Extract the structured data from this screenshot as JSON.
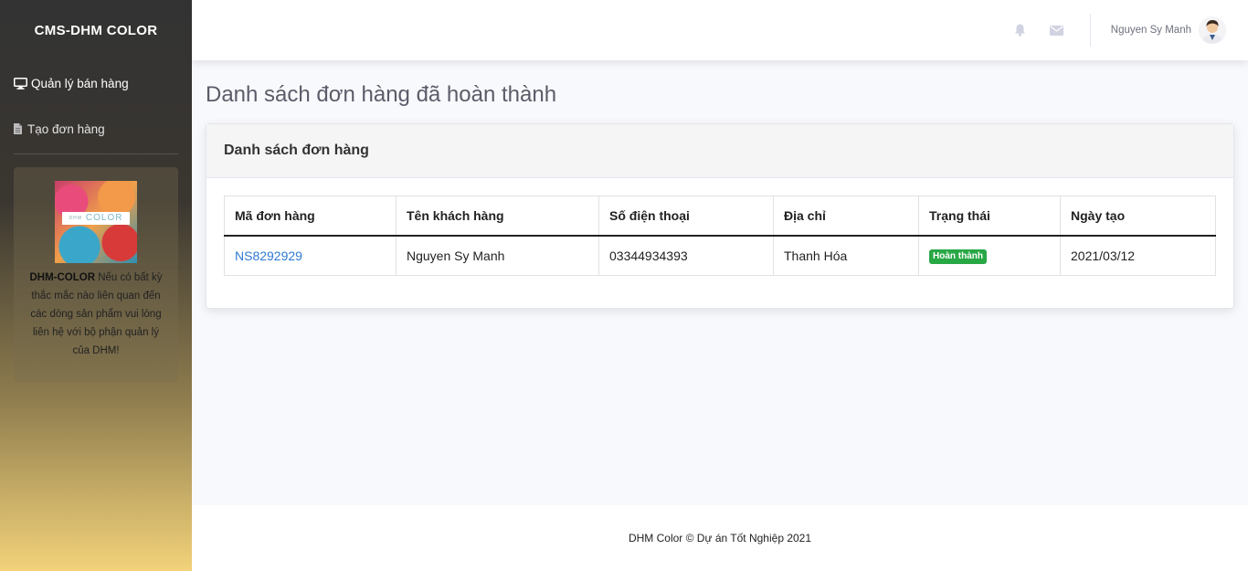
{
  "sidebar": {
    "brand": "CMS-DHM COLOR",
    "items": [
      {
        "label": "Quản lý bán hàng",
        "icon": "monitor-icon"
      },
      {
        "label": "Tạo đơn hàng",
        "icon": "file-icon"
      }
    ],
    "promo": {
      "logo_small": "DHM",
      "logo_text": "COLOR",
      "brand": "DHM-COLOR",
      "text": " Nếu có bất kỳ thắc mắc nào liên quan đến các dòng sản phẩm vui lòng liên hệ với bộ phận quản lý của DHM!"
    }
  },
  "topbar": {
    "user_name": "Nguyen Sy Manh",
    "icons": [
      "bell-icon",
      "envelope-icon"
    ]
  },
  "page": {
    "title": "Danh sách đơn hàng đã hoàn thành"
  },
  "card": {
    "header": "Danh sách đơn hàng"
  },
  "table": {
    "columns": [
      "Mã đơn hàng",
      "Tên khách hàng",
      "Số điện thoại",
      "Địa chỉ",
      "Trạng thái",
      "Ngày tạo"
    ],
    "rows": [
      {
        "order_id": "NS8292929",
        "customer": "Nguyen Sy Manh",
        "phone": "03344934393",
        "address": "Thanh Hóa",
        "status": "Hoàn thành",
        "created": "2021/03/12"
      }
    ]
  },
  "footer": {
    "text": "DHM Color © Dự án Tốt Nghiệp 2021"
  },
  "colors": {
    "accent": "#2e7bd3",
    "status_success": "#28a745"
  }
}
